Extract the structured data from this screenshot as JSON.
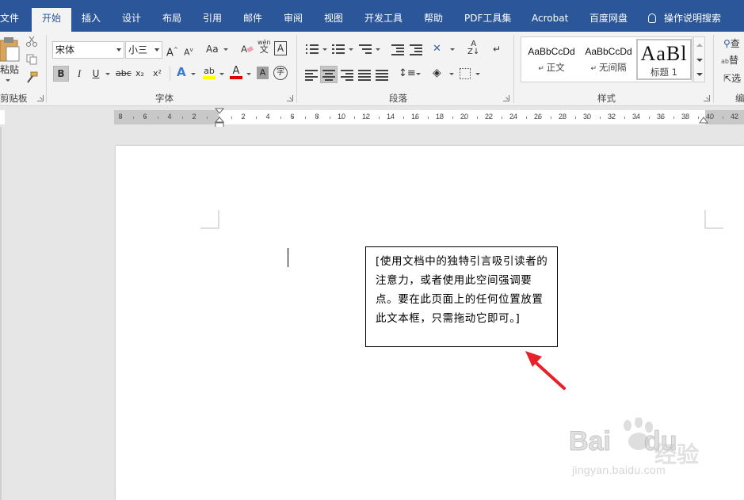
{
  "tabs": {
    "file": "文件",
    "home": "开始",
    "insert": "插入",
    "design": "设计",
    "layout": "布局",
    "references": "引用",
    "mailings": "邮件",
    "review": "审阅",
    "view": "视图",
    "developer": "开发工具",
    "help": "帮助",
    "pdf_tools": "PDF工具集",
    "acrobat": "Acrobat",
    "baidu_disk": "百度网盘",
    "tell_me": "操作说明搜索"
  },
  "clipboard": {
    "paste_label": "粘贴",
    "group_label": "剪贴板"
  },
  "font": {
    "font_name": "宋体",
    "font_size": "小三",
    "group_label": "字体",
    "case_label": "Aa",
    "bold": "B",
    "italic": "I",
    "underline": "U",
    "strike": "abc",
    "subscript": "x₂",
    "superscript": "x²",
    "grow": "A",
    "shrink": "A",
    "effects": "A",
    "highlight": "ab",
    "color": "A",
    "shade": "A",
    "char_border": "A",
    "enclose": "字",
    "phonetic": "wén"
  },
  "paragraph": {
    "group_label": "段落"
  },
  "styles": {
    "group_label": "样式",
    "items": [
      {
        "sample": "AaBbCcDd",
        "name": "正文"
      },
      {
        "sample": "AaBbCcDd",
        "name": "无间隔"
      },
      {
        "sample": "AaBl",
        "name": "标题 1"
      }
    ]
  },
  "editing": {
    "find": "查",
    "replace": "替",
    "select": "选",
    "group_label": "编"
  },
  "ruler": {
    "left_labels": [
      "8",
      "6",
      "4",
      "2"
    ],
    "right_labels": [
      "2",
      "4",
      "6",
      "8",
      "10",
      "12",
      "14",
      "16",
      "18",
      "20",
      "22",
      "24",
      "26",
      "28",
      "30",
      "32",
      "34",
      "36",
      "38",
      "40",
      "42"
    ]
  },
  "document": {
    "textbox_text": "[使用文档中的独特引言吸引读者的注意力，或者使用此空间强调要点。要在此页面上的任何位置放置此文本框，只需拖动它即可。]"
  },
  "watermark": {
    "brand": "Bai",
    "brand2": "du",
    "cn": "经验",
    "url": "jingyan.baidu.com"
  },
  "colors": {
    "ribbon_blue": "#2b579a",
    "arrow_red": "#e8202a",
    "highlight": "#ffff00",
    "font_red": "#e00000"
  }
}
